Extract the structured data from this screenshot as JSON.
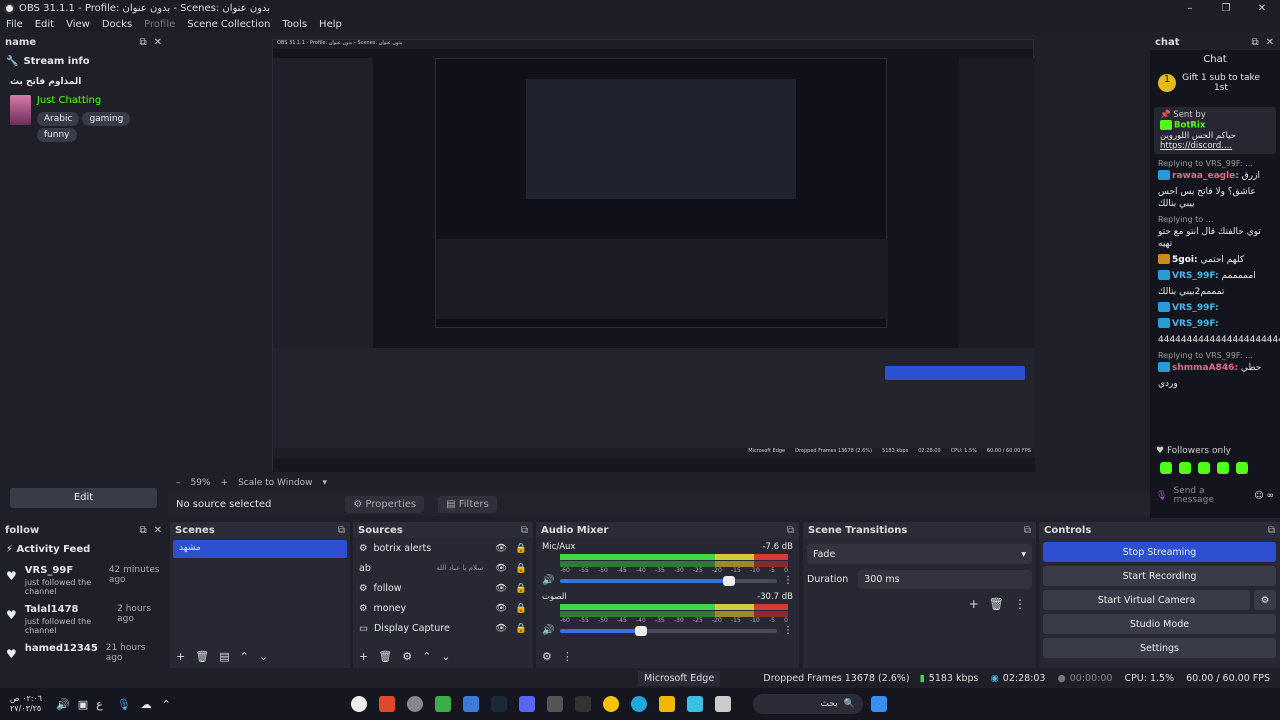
{
  "window": {
    "title": "OBS 31.1.1 - Profile: بدون عنوان - Scenes: بدون عنوان",
    "controls": [
      "–",
      "❐",
      "✕"
    ]
  },
  "menu": [
    "File",
    "Edit",
    "View",
    "Docks",
    "Profile",
    "Scene Collection",
    "Tools",
    "Help"
  ],
  "name_dock": {
    "header": "name",
    "stream_info_title": "Stream info",
    "channel": "المذاوم فاتح بث",
    "category": "Just Chatting",
    "tags": [
      "Arabic",
      "gaming",
      "funny"
    ],
    "edit": "Edit"
  },
  "preview": {
    "zoom": "59%",
    "scale_mode": "Scale to Window",
    "no_source": "No source selected",
    "properties": "Properties",
    "filters": "Filters",
    "inner_title": "OBS 31.1.1 - Profile: بدون عنوان - Scenes: بدون عنوان",
    "tooltip_inner": "Microsoft Edge",
    "inner_dropped": "Dropped Frames 13678 (2.6%)",
    "inner_kbps": "5183 kbps",
    "inner_time": "02:28:03",
    "inner_cpu": "CPU: 1.5%",
    "inner_fps": "60.00 / 60.00 FPS"
  },
  "follow_dock": {
    "header": "follow",
    "title": "Activity Feed",
    "items": [
      {
        "name": "VRS_99F",
        "sub": "just followed the channel",
        "time": "42 minutes ago"
      },
      {
        "name": "Talal1478",
        "sub": "just followed the channel",
        "time": "2 hours ago"
      },
      {
        "name": "hamed12345",
        "sub": "",
        "time": "21 hours ago"
      }
    ]
  },
  "scenes": {
    "header": "Scenes",
    "items": [
      "مشهد"
    ]
  },
  "sources": {
    "header": "Sources",
    "items": [
      {
        "icon": "⚙",
        "name": "botrix alerts"
      },
      {
        "icon": "ab",
        "name": "سلام يا عباد الله"
      },
      {
        "icon": "⚙",
        "name": "follow"
      },
      {
        "icon": "⚙",
        "name": "money"
      },
      {
        "icon": "▭",
        "name": "Display Capture"
      }
    ]
  },
  "mixer": {
    "header": "Audio Mixer",
    "channels": [
      {
        "name": "Mic/Aux",
        "db": "-7.6 dB",
        "volume": 0.78
      },
      {
        "name": "الصوت",
        "db": "-30.7 dB",
        "volume": 0.37
      }
    ],
    "ticks": [
      "-60",
      "-55",
      "-50",
      "-45",
      "-40",
      "-35",
      "-30",
      "-25",
      "-20",
      "-15",
      "-10",
      "-5",
      "0"
    ]
  },
  "transitions": {
    "header": "Scene Transitions",
    "selected": "Fade",
    "duration_label": "Duration",
    "duration": "300 ms"
  },
  "controls": {
    "header": "Controls",
    "stop_streaming": "Stop Streaming",
    "start_recording": "Start Recording",
    "start_virtual_camera": "Start Virtual Camera",
    "studio_mode": "Studio Mode",
    "settings": "Settings"
  },
  "chat": {
    "header": "chat",
    "title": "Chat",
    "pinned_gift": "Gift 1 sub to take 1st",
    "sent_by": "Sent by",
    "pinned_user": "BotRix",
    "pinned_text1": "حياكم الحس اللوروين",
    "pinned_link": "https://discord....",
    "lines": [
      {
        "pre": "Replying to VRS_99F: ...",
        "name": "rawaa_eagle:",
        "text": "ازرق",
        "name_color": "pink"
      },
      {
        "pre": "",
        "name": "",
        "text": "عاشق؟ ولا فاتح بس احس بيبي بنالك",
        "name_color": "blue"
      },
      {
        "pre": "Replying to ...",
        "name": "",
        "text": "توي حالفتك قال انتو مع حتو تهيه",
        "name_color": "blue"
      },
      {
        "pre": "",
        "name": "5goi:",
        "text": "كلهم احتمي",
        "name_color": "white"
      },
      {
        "pre": "",
        "name": "VRS_99F:",
        "text": "امممممم",
        "name_color": "blue"
      },
      {
        "pre": "",
        "name": "",
        "text": "تمممم2بيبي بنالك",
        "name_color": "blue"
      },
      {
        "pre": "",
        "name": "VRS_99F:",
        "text": "",
        "name_color": "blue"
      },
      {
        "pre": "",
        "name": "VRS_99F:",
        "text": "",
        "name_color": "blue"
      },
      {
        "pre": "",
        "name": "",
        "text": "44444444444444444444444444",
        "name_color": "blue"
      },
      {
        "pre": "Replying to VRS_99F: ...",
        "name": "shmmaA846:",
        "text": "حطي",
        "name_color": "pink"
      },
      {
        "pre": "",
        "name": "",
        "text": "وردي",
        "name_color": "blue"
      }
    ],
    "followers_only": "Followers only",
    "send_placeholder": "Send a message"
  },
  "status": {
    "tooltip": "Microsoft Edge",
    "dropped": "Dropped Frames 13678 (2.6%)",
    "kbps": "5183 kbps",
    "stream_time": "02:28:03",
    "rec_time": "00:00:00",
    "cpu": "CPU: 1.5%",
    "fps": "60.00 / 60.00 FPS"
  },
  "taskbar": {
    "clock_time": "٠٢:٠٦ ص",
    "clock_date": "٢٧/٠٣/٢٥",
    "lang": "ع",
    "search": "بحث"
  }
}
